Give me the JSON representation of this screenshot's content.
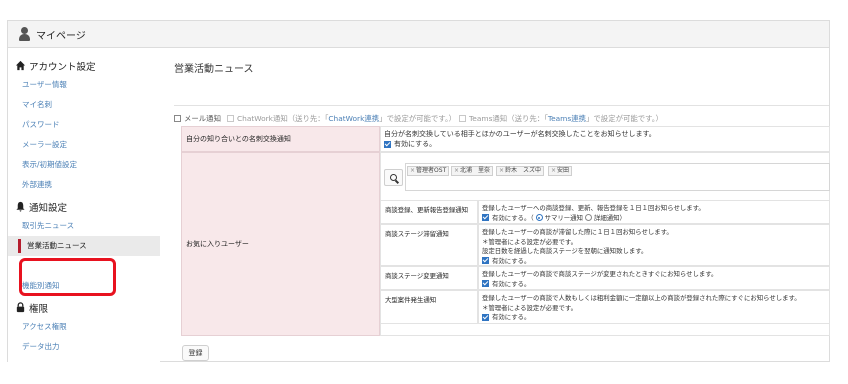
{
  "header": {
    "title": "マイページ",
    "icon": "user-icon"
  },
  "sidebar": {
    "sections": [
      {
        "heading": "アカウント設定",
        "icon": "home-icon",
        "items": [
          "ユーザー情報",
          "マイ名刺",
          "パスワード",
          "メーラー設定",
          "表示/初期値設定",
          "外部連携"
        ]
      },
      {
        "heading": "通知設定",
        "icon": "bell-icon",
        "items": [
          "取引先ニュース",
          "営業活動ニュース",
          "機能別通知"
        ]
      },
      {
        "heading": "権限",
        "icon": "lock-icon",
        "items": [
          "アクセス権限",
          "データ出力"
        ]
      }
    ],
    "active_item": "営業活動ニュース"
  },
  "main": {
    "title": "営業活動ニュース",
    "notify": {
      "mail": "メール通知",
      "chatwork_prefix": "ChatWork通知（送り先：「",
      "chatwork_link": "ChatWork連携",
      "chatwork_suffix": "」で設定が可能です。）",
      "teams_prefix": "Teams通知（送り先：「",
      "teams_link": "Teams連携",
      "teams_suffix": "」で設定が可能です。）"
    },
    "rows": {
      "exchange_label": "自分の知り合いとの名刺交換通知",
      "exchange_desc": "自分が名刺交換している相手とほかのユーザーが名刺交換したことをお知らせします。",
      "enable": "有効にする。",
      "favorite_label": "お気に入りユーザー",
      "tags": [
        "管理者OST",
        "北浦　里奈",
        "鈴木　スズ中",
        "安田"
      ]
    },
    "sub_rows": [
      {
        "label": "商談登録、更新報告登録通知",
        "lines": [
          "登録したユーザーへの商談登録、更新、報告登録を１日１回お知らせします。"
        ],
        "enable": "有効にする。（",
        "radio_summary": "サマリー通知",
        "radio_detail": "詳細通知",
        "close": "）"
      },
      {
        "label": "商談ステージ滞留通知",
        "lines": [
          "登録したユーザーの商談が滞留した際に１日１回お知らせします。",
          "＊管理者による設定が必要です。",
          "設定日数を経過した商談ステージを翌朝に通知致します。"
        ],
        "enable": "有効にする。"
      },
      {
        "label": "商談ステージ変更通知",
        "lines": [
          "登録したユーザーの商談で商談ステージが変更されたときすぐにお知らせします。"
        ],
        "enable": "有効にする。"
      },
      {
        "label": "大型案件発生通知",
        "lines": [
          "登録したユーザーの商談で人数もしくは粗利金額に一定額以上の商談が登録された際にすぐにお知らせします。",
          "＊管理者による設定が必要です。"
        ],
        "enable": "有効にする。"
      }
    ],
    "save_label": "登録"
  },
  "colors": {
    "accent": "#b51d2e",
    "link": "#4a7fb5",
    "label_bg": "#f8e8ea",
    "highlight": "#e8121f",
    "checkbox": "#2f74c2"
  }
}
